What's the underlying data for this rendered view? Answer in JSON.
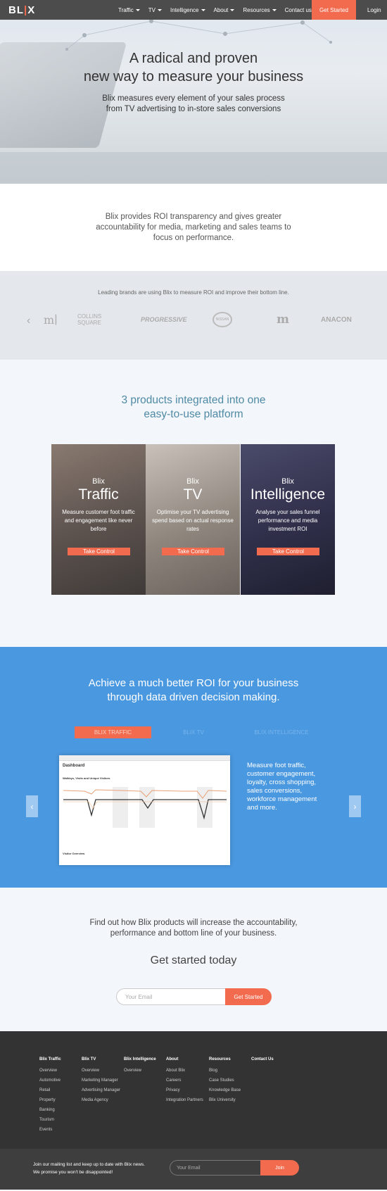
{
  "nav": {
    "logo": "BLIX",
    "items": [
      "Traffic",
      "TV",
      "Intelligence",
      "About",
      "Resources",
      "Contact us"
    ],
    "cta": "Get Started",
    "login": "Login"
  },
  "hero": {
    "title_line1": "A radical and proven",
    "title_line2": "new way to measure your business",
    "sub_line1": "Blix measures every element of your sales process",
    "sub_line2": "from TV advertising to in-store sales conversions"
  },
  "intro": {
    "text": "Blix provides ROI transparency and gives greater accountability for media, marketing and sales teams to focus on performance."
  },
  "brands": {
    "text": "Leading brands are using Blix to measure ROI and improve their bottom line.",
    "logos": [
      "COLLINS SQUARE",
      "PROGRESSIVE",
      "NISSAN",
      "m",
      "ANACON"
    ]
  },
  "products": {
    "title_line1": "3 products integrated into one",
    "title_line2": "easy-to-use platform",
    "cards": [
      {
        "label": "Blix",
        "title": "Traffic",
        "desc": "Measure customer foot traffic and engagement like never before",
        "button": "Take Control"
      },
      {
        "label": "Blix",
        "title": "TV",
        "desc": "Optimise your TV advertising spend based on actual response rates",
        "button": "Take Control"
      },
      {
        "label": "Blix",
        "title": "Intelligence",
        "desc": "Analyse your sales funnel performance and media investment ROI",
        "button": "Take Control"
      }
    ]
  },
  "roi": {
    "title_line1": "Achieve a much better ROI for your business",
    "title_line2": "through data driven decision making.",
    "tabs": [
      "BLIX TRAFFIC",
      "BLIX TV",
      "BLIX INTELLIGENCE"
    ],
    "copy": "Measure foot traffic, customer engagement, loyalty, cross shopping, sales conversions, workforce management and more.",
    "screenshot": {
      "title": "Dashboard",
      "chart_title": "Walkbys, Visits and Unique Visitors",
      "panel": "Visitor Overview"
    }
  },
  "getstarted": {
    "text_line1": "Find out how Blix products will increase the accountability,",
    "text_line2": "performance and bottom line of your business.",
    "title": "Get started today",
    "placeholder": "Your Email",
    "button": "Get Started"
  },
  "footer": {
    "columns": [
      {
        "heading": "Blix Traffic",
        "items": [
          "Overview",
          "Automotive",
          "Retail",
          "Property",
          "Banking",
          "Tourism",
          "Events"
        ]
      },
      {
        "heading": "Blix TV",
        "items": [
          "Overview",
          "Marketing Manager",
          "Advertising Manager",
          "Media Agency"
        ]
      },
      {
        "heading": "Blix Intelligence",
        "items": [
          "Overview"
        ]
      },
      {
        "heading": "About",
        "items": [
          "About Blix",
          "Careers",
          "Privacy",
          "Integration Partners"
        ]
      },
      {
        "heading": "Resources",
        "items": [
          "Blog",
          "Case Studies",
          "Knowledge Base",
          "Blix University"
        ]
      },
      {
        "heading": "Contact Us",
        "items": []
      }
    ]
  },
  "mailbar": {
    "line1": "Join our mailing list and keep up to date with Blix news.",
    "line2": "We promise you won't be disappointed!",
    "placeholder": "Your Email",
    "button": "Join"
  },
  "colors": {
    "accent": "#f26b4f",
    "blue": "#4a98e0",
    "teal": "#4f8aa5",
    "dark": "#333333"
  }
}
